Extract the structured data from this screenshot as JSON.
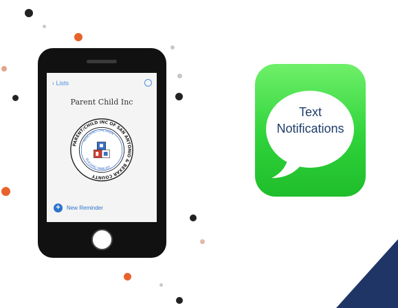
{
  "phone": {
    "screen": {
      "back_label": "Lists",
      "title": "Parent Child Inc",
      "new_reminder_label": "New Reminder",
      "plus_symbol": "+"
    },
    "seal": {
      "outer_text": "PARENT/CHILD INC OF SAN ANTONIO & BEXAR COUNTY",
      "inner_top_text": "REACHING CHILDREN",
      "inner_bottom_text": "BUILDING FAMILIES"
    }
  },
  "messages_icon": {
    "label_line1": "Text",
    "label_line2": "Notifications"
  },
  "colors": {
    "accent_orange": "#e8632c",
    "dot_dark": "#222222",
    "dot_light": "#c8c8c8",
    "messages_green": "#34d13f",
    "ios_blue": "#2a73c9",
    "navy_corner": "#1f3566"
  }
}
